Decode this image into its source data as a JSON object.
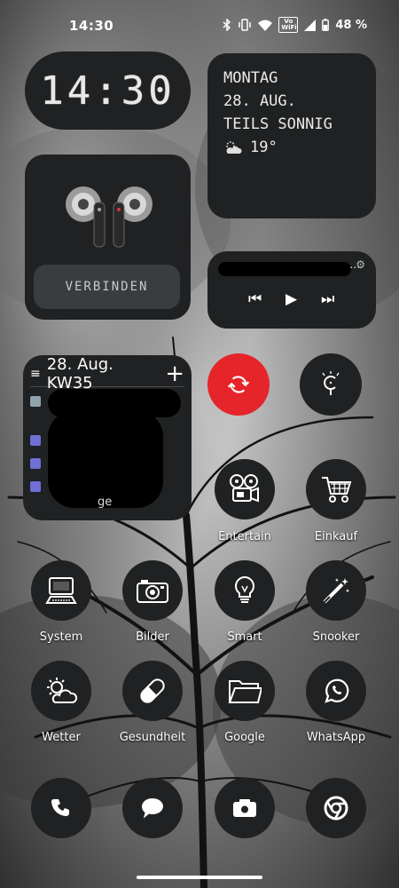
{
  "status_bar": {
    "time": "14:30",
    "battery": "48 %",
    "vowifi_line1": "Vo",
    "vowifi_line2": "WiFi"
  },
  "clock_widget": {
    "time": "14:30"
  },
  "weather_widget": {
    "day": "MONTAG",
    "date": "28. AUG.",
    "condition": "TEILS SONNIG",
    "temperature": "19°"
  },
  "earbuds_widget": {
    "connect_label": "VERBINDEN"
  },
  "media_widget": {
    "title_suffix": "...",
    "controls": [
      "previous",
      "play",
      "next"
    ]
  },
  "calendar_widget": {
    "header": "28. Aug. KW35",
    "add": "+",
    "menu": "≡",
    "tail_text": "ge",
    "item_colors": [
      "#8fa3ad",
      "#6f6fd6",
      "#6f6fd6",
      "#6f6fd6"
    ]
  },
  "accent_color": "#e5252a",
  "apps": [
    {
      "label": "Entertain",
      "icon": "film-projector-icon"
    },
    {
      "label": "Einkauf",
      "icon": "shopping-cart-icon"
    },
    {
      "label": "System",
      "icon": "computer-icon"
    },
    {
      "label": "Bilder",
      "icon": "camera-icon"
    },
    {
      "label": "Smart",
      "icon": "light-bulb-icon"
    },
    {
      "label": "Snooker",
      "icon": "magic-wand-icon"
    },
    {
      "label": "Wetter",
      "icon": "weather-icon"
    },
    {
      "label": "Gesundheit",
      "icon": "pill-icon"
    },
    {
      "label": "Google",
      "icon": "folder-icon"
    },
    {
      "label": "WhatsApp",
      "icon": "whatsapp-icon"
    }
  ],
  "dock": [
    {
      "icon": "phone-icon"
    },
    {
      "icon": "messages-icon"
    },
    {
      "icon": "camera-app-icon"
    },
    {
      "icon": "chrome-icon"
    }
  ]
}
